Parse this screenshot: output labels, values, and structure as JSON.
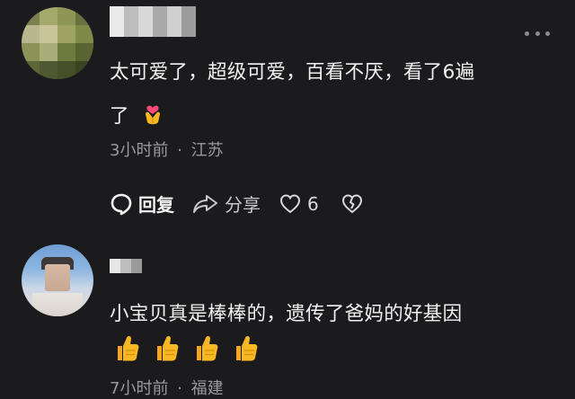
{
  "comment_1": {
    "line_1": "太可爱了，超级可爱，百看不厌，看了6遍",
    "line_2": "了",
    "time": "3小时前",
    "separator": "·",
    "location": "江苏",
    "reply_label": "回复",
    "share_label": "分享",
    "like_count": "6",
    "emoji": "heart-hands-emoji"
  },
  "comment_2": {
    "text": "小宝贝真是棒棒的，遗传了爸妈的好基因",
    "emojis": [
      "thumbs-up-emoji",
      "thumbs-up-emoji",
      "thumbs-up-emoji",
      "thumbs-up-emoji"
    ],
    "time": "7小时前",
    "separator": "·",
    "location": "福建"
  },
  "colors": {
    "background": "#1b1b1d",
    "text": "#f1f1f1",
    "meta": "#9a9a9c",
    "emoji_yellow": "#f7b824"
  }
}
